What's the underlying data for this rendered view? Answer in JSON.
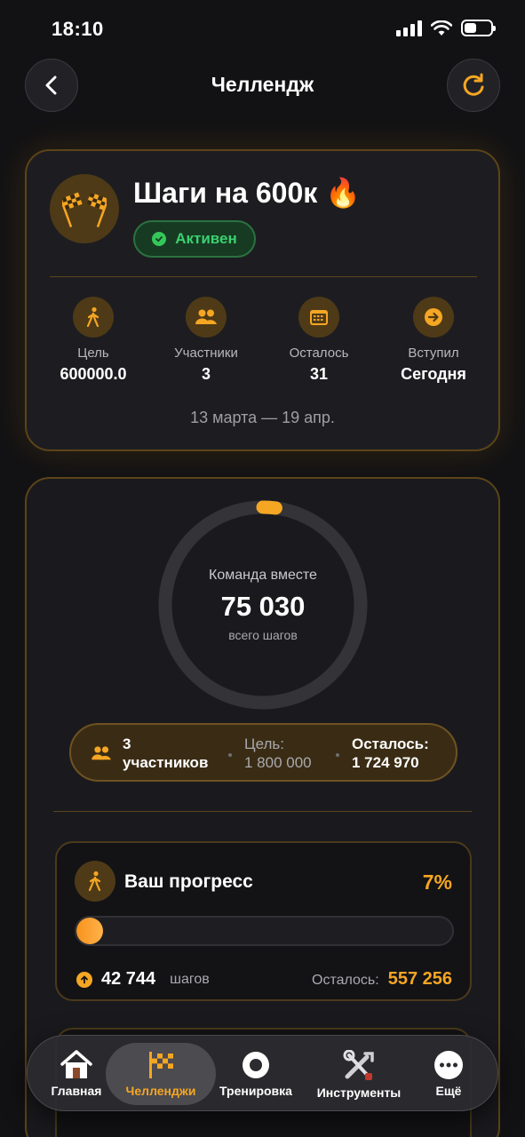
{
  "status_bar": {
    "time": "18:10"
  },
  "header": {
    "title": "Челлендж"
  },
  "challenge": {
    "title": "Шаги на 600к 🔥",
    "status": "Активен",
    "stats": [
      {
        "icon": "walking-person-icon",
        "label": "Цель",
        "value": "600000.0"
      },
      {
        "icon": "participants-icon",
        "label": "Участники",
        "value": "3"
      },
      {
        "icon": "calendar-icon",
        "label": "Осталось",
        "value": "31"
      },
      {
        "icon": "arrow-right-circle-icon",
        "label": "Вступил",
        "value": "Сегодня"
      }
    ],
    "dates": "13 марта — 19 апр."
  },
  "team": {
    "ring_label": "Команда вместе",
    "total_steps": "75 030",
    "total_steps_label": "всего шагов",
    "ring_progress_fraction": 0.042,
    "participants_count": "3",
    "participants_word": "участников",
    "goal_label": "Цель:",
    "goal_value": "1 800 000",
    "remaining_label": "Осталось:",
    "remaining_value": "1 724 970"
  },
  "progress": {
    "title": "Ваш прогресс",
    "percent": "7%",
    "fraction": 0.07,
    "steps_value": "42 744",
    "steps_unit": "шагов",
    "remaining_label": "Осталось:",
    "remaining_value": "557 256"
  },
  "tabbar": {
    "items": [
      {
        "label": "Главная",
        "icon": "home-icon"
      },
      {
        "label": "Челленджи",
        "icon": "checkered-flag-icon",
        "active": true
      },
      {
        "label": "Тренировка",
        "icon": "record-circle-icon"
      },
      {
        "label": "Инструменты",
        "icon": "tools-icon"
      },
      {
        "label": "Ещё",
        "icon": "more-dots-icon"
      }
    ]
  },
  "colors": {
    "accent": "#f5a623",
    "background": "#121214",
    "card": "#1d1d21",
    "active_green": "#3bd16f"
  }
}
